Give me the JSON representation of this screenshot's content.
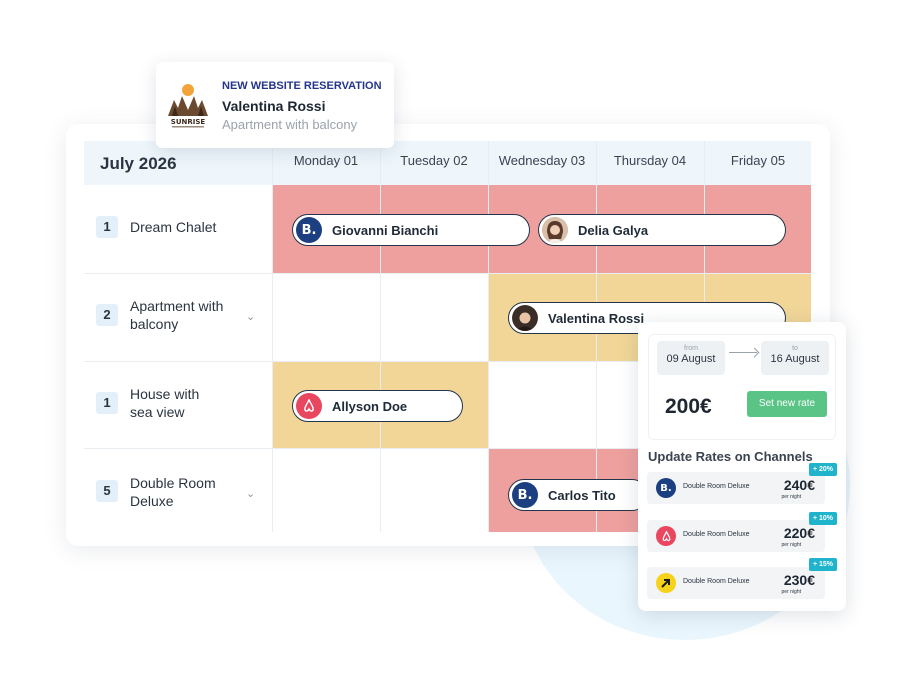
{
  "calendar": {
    "month": "July 2026",
    "days": [
      "Monday 01",
      "Tuesday 02",
      "Wednesday 03",
      "Thursday 04",
      "Friday 05"
    ],
    "rooms": [
      {
        "count": "1",
        "name": "Dream Chalet",
        "expandable": false
      },
      {
        "count": "2",
        "name": "Apartment with balcony",
        "expandable": true
      },
      {
        "count": "1",
        "name": "House with sea view",
        "expandable": false
      },
      {
        "count": "5",
        "name": "Double Room Deluxe",
        "expandable": true
      }
    ],
    "bookings": [
      {
        "guest": "Giovanni Bianchi",
        "channel": "booking-icon"
      },
      {
        "guest": "Delia Galya",
        "channel": "guest-avatar"
      },
      {
        "guest": "Valentina Rossi",
        "channel": "guest-avatar"
      },
      {
        "guest": "Allyson Doe",
        "channel": "airbnb-icon"
      },
      {
        "guest": "Carlos Tito",
        "channel": "booking-icon"
      }
    ],
    "colors": {
      "red_block": "#eea09e",
      "yellow_block": "#f1d697",
      "header": "#eef6fc"
    }
  },
  "notification": {
    "tag": "NEW WEBSITE RESERVATION",
    "guest": "Valentina Rossi",
    "room": "Apartment with balcony",
    "logo_text": "SUNRISE"
  },
  "rates": {
    "from_label": "from",
    "from_date": "09 August",
    "to_label": "to",
    "to_date": "16 August",
    "price": "200€",
    "set_button": "Set new rate",
    "channels_title": "Update Rates on Channels",
    "channels": [
      {
        "icon": "booking-icon",
        "room": "Double Room Deluxe",
        "price": "240€",
        "per": "per night",
        "badge": "+ 20%"
      },
      {
        "icon": "airbnb-icon",
        "room": "Double Room Deluxe",
        "price": "220€",
        "per": "per night",
        "badge": "+ 10%"
      },
      {
        "icon": "expedia-icon",
        "room": "Double Room Deluxe",
        "price": "230€",
        "per": "per night",
        "badge": "+ 15%"
      }
    ],
    "colors": {
      "set_button": "#59c485",
      "badge": "#1fb3cc"
    }
  }
}
